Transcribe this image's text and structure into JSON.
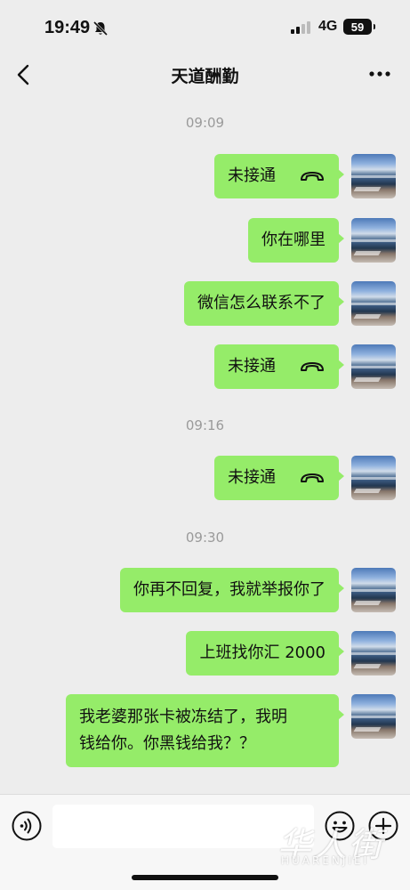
{
  "status_bar": {
    "time": "19:49",
    "network": "4G",
    "battery": "59",
    "icons": [
      "bell-off-icon",
      "signal-icon"
    ]
  },
  "nav": {
    "title": "天道酬勤",
    "icons": [
      "back-icon",
      "more-icon"
    ]
  },
  "timestamps": [
    "09:09",
    "09:16",
    "09:30"
  ],
  "messages": [
    {
      "text": "未接通",
      "type": "call"
    },
    {
      "text": "你在哪里",
      "type": "text"
    },
    {
      "text": "微信怎么联系不了",
      "type": "text"
    },
    {
      "text": "未接通",
      "type": "call"
    },
    {
      "text": "未接通",
      "type": "call"
    },
    {
      "text": "你再不回复，我就举报你了",
      "type": "text"
    },
    {
      "text": "上班找你汇 2000",
      "type": "text"
    },
    {
      "text": "我老婆那张卡被冻结了，我明",
      "text2": "钱给你。你黑钱给我？？",
      "type": "text"
    }
  ],
  "input_bar": {
    "icons": [
      "voice-icon",
      "emoji-icon",
      "plus-icon"
    ],
    "value": ""
  },
  "watermark": {
    "cn": "华人街",
    "en": "HUARENJIEI"
  },
  "colors": {
    "background": "#ededed",
    "bubble": "#95ec69",
    "timestamp": "#9a9a9a"
  }
}
